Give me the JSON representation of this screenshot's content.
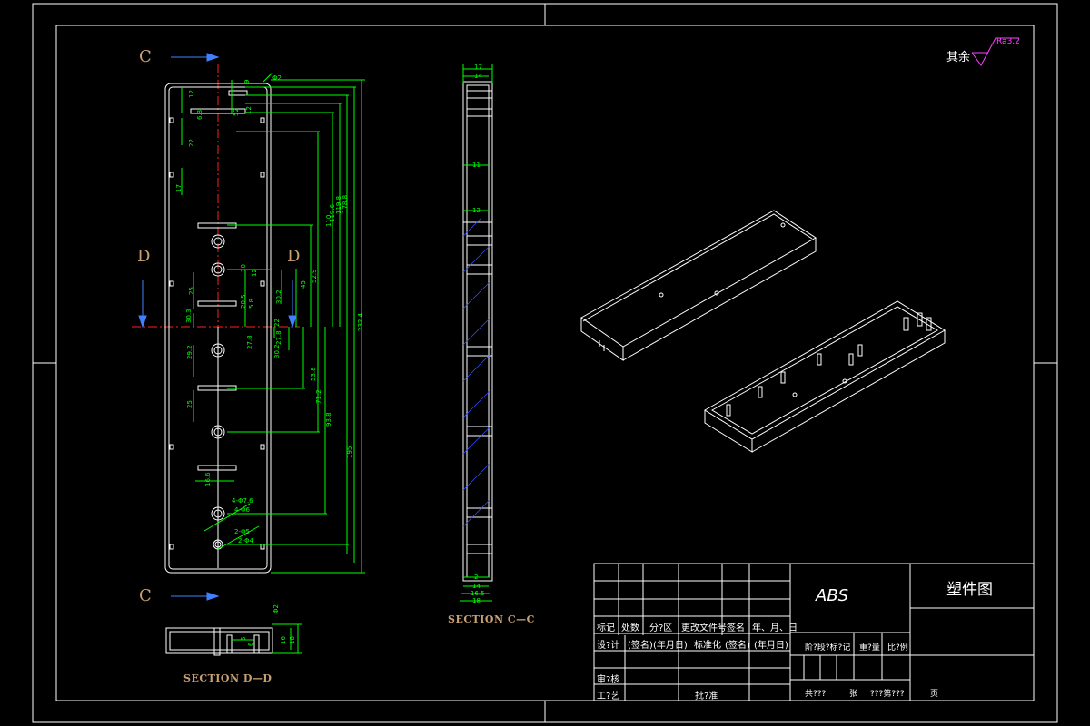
{
  "labels": {
    "c_top": "C",
    "c_bottom": "C",
    "d_left": "D",
    "d_right": "D",
    "section_cc": "SECTION C—C",
    "section_dd": "SECTION D—D",
    "roughness_text": "其余",
    "roughness_value": "Ra3.2"
  },
  "title_block": {
    "material": "ABS",
    "drawing_name": "塑件图",
    "row_marks": [
      "标记",
      "处数",
      "分?区",
      "更改文件号",
      "签名",
      "年、月、日"
    ],
    "row_design": [
      "设?计",
      "(签名)",
      "(年月日)",
      "标准化",
      "(签名)",
      "(年月日)"
    ],
    "stage_labels": [
      "阶?段?标?记",
      "重?量",
      "比?例"
    ],
    "review": "审?核",
    "process": "工?艺",
    "approve": "批?准",
    "sheet_total": "共???",
    "sheet_label": "张",
    "sheet_num": "???第???",
    "page": "页"
  },
  "dimensions": {
    "top_view_left": [
      "12",
      "6.8",
      "22",
      "17",
      "25",
      "30.3",
      "29.2",
      "25"
    ],
    "top_view_right": [
      "9",
      "52",
      "12",
      "10",
      "12",
      "20.5",
      "5.8",
      "30.2",
      "27.8",
      "22",
      "27.8",
      "30.2",
      "53.8",
      "45",
      "71.2",
      "93.8",
      "52.9",
      "110",
      "119.6",
      "119.8",
      "178.8",
      "195",
      "232.4",
      "16.6"
    ],
    "holes": [
      "4-Φ7.6",
      "4-Φ6",
      "2-Φ5",
      "2-Φ4",
      "Φ2"
    ],
    "section_cc": [
      "17",
      "14",
      "11",
      "12",
      "2",
      "14",
      "16.5",
      "18"
    ],
    "section_dd": [
      "Φ2",
      "18",
      "16",
      "6",
      "6"
    ]
  },
  "colors": {
    "frame": "#ffffff",
    "dimension": "#00ff00",
    "center_line": "#ff2020",
    "hatch": "#3050ff",
    "label": "#c8a070",
    "roughness": "#ff40ff"
  }
}
